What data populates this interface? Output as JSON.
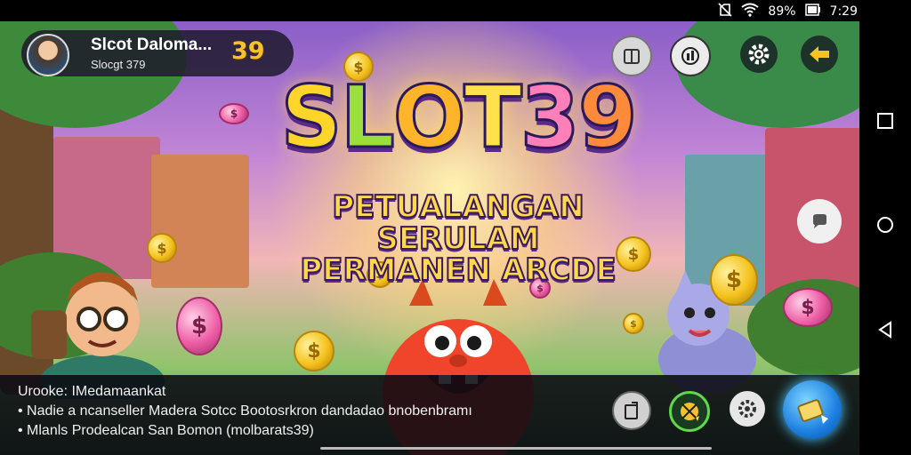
{
  "status_bar": {
    "battery": "89%",
    "time": "7:29",
    "icons": [
      "no-sim-icon",
      "wifi-icon",
      "battery-icon"
    ]
  },
  "profile": {
    "name": "Slcot Daloma...",
    "subtitle": "Slocgt 379",
    "number": "39"
  },
  "top_buttons": [
    "inventory-icon",
    "leaderboard-icon",
    "gear-icon",
    "back-arrow-icon"
  ],
  "banner": {
    "title_letters": [
      "S",
      "L",
      "O",
      "T",
      "3",
      "9"
    ],
    "subtitle_line1": "PETUALANGAN SERULAM",
    "subtitle_line2": "PERMANEN ARCDE"
  },
  "info_panel": {
    "line1": "Urooke: IMedamaankat",
    "line2": "• Nadie a ncanseller Madera Sotcc Bootosrkron dandadao bnobenbramı",
    "line3": "• Mlanls Prodealcan San Bomon (molbarats39)"
  },
  "bottom_buttons": [
    "share-icon",
    "lucky-wheel-icon",
    "gear-icon",
    "play-ticket-icon"
  ],
  "colors": {
    "accent_gold": "#f6c22a",
    "panel": "#1e192d",
    "play_button": "#1c7fe0"
  }
}
